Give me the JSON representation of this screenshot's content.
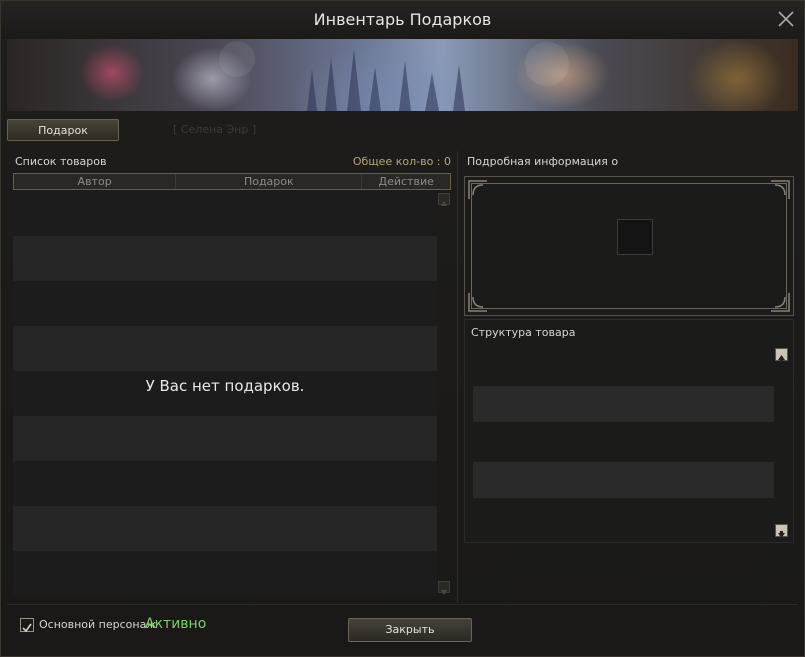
{
  "window": {
    "title": "Инвентарь Подарков"
  },
  "tabs": {
    "gift_label": "Подарок",
    "ghost_label": "[ Селена Энр ]"
  },
  "list": {
    "title": "Список товаров",
    "total": "Общее кол-во : 0",
    "columns": [
      "Автор",
      "Подарок",
      "Действие"
    ],
    "empty_message": "У Вас нет подарков."
  },
  "details": {
    "title": "Подробная информация о",
    "structure_title": "Структура товара"
  },
  "footer": {
    "main_char_label": "Основной персонаж",
    "status": "Активно",
    "close_label": "Закрыть",
    "checkbox_checked": true
  },
  "colors": {
    "active_status": "#7fcf6a",
    "accent_border": "#6a5f45"
  },
  "icons": [
    "close-icon",
    "checkmark-icon",
    "arrow-up-icon",
    "arrow-down-icon",
    "ornament-corner-icon"
  ]
}
